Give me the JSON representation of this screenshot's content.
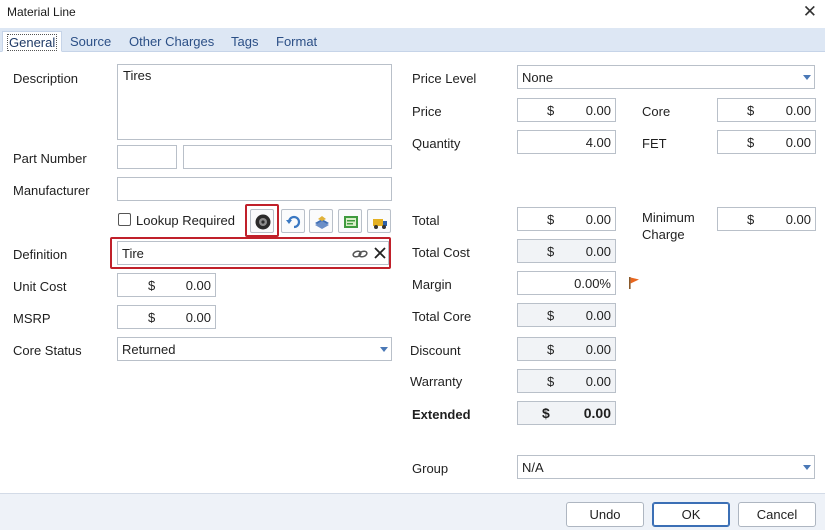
{
  "window": {
    "title": "Material Line",
    "close_symbol": "✕"
  },
  "tabs": [
    {
      "label": "General",
      "active": true
    },
    {
      "label": "Source"
    },
    {
      "label": "Other Charges"
    },
    {
      "label": "Tags"
    },
    {
      "label": "Format"
    }
  ],
  "left": {
    "description_label": "Description",
    "description_value": "Tires",
    "part_number_label": "Part Number",
    "part_number_value_1": "",
    "part_number_value_2": "",
    "manufacturer_label": "Manufacturer",
    "manufacturer_value": "",
    "lookup_label": "Lookup Required",
    "lookup_checked": false,
    "definition_label": "Definition",
    "definition_value": "Tire",
    "unit_cost_label": "Unit Cost",
    "unit_cost_currency": "$",
    "unit_cost_value": "0.00",
    "msrp_label": "MSRP",
    "msrp_currency": "$",
    "msrp_value": "0.00",
    "core_status_label": "Core Status",
    "core_status_value": "Returned"
  },
  "right": {
    "price_level_label": "Price Level",
    "price_level_value": "None",
    "price_label": "Price",
    "price_currency": "$",
    "price_value": "0.00",
    "core_label": "Core",
    "core_currency": "$",
    "core_value": "0.00",
    "quantity_label": "Quantity",
    "quantity_value": "4.00",
    "fet_label": "FET",
    "fet_currency": "$",
    "fet_value": "0.00",
    "total_label": "Total",
    "total_currency": "$",
    "total_value": "0.00",
    "minimum_charge_label_1": "Minimum",
    "minimum_charge_label_2": "Charge",
    "minimum_charge_currency": "$",
    "minimum_charge_value": "0.00",
    "total_cost_label": "Total Cost",
    "total_cost_currency": "$",
    "total_cost_value": "0.00",
    "margin_label": "Margin",
    "margin_value": "0.00%",
    "total_core_label": "Total Core",
    "total_core_currency": "$",
    "total_core_value": "0.00",
    "discount_label": "Discount",
    "discount_currency": "$",
    "discount_value": "0.00",
    "warranty_label": "Warranty",
    "warranty_currency": "$",
    "warranty_value": "0.00",
    "extended_label": "Extended",
    "extended_currency": "$",
    "extended_value": "0.00",
    "group_label": "Group",
    "group_value": "N/A"
  },
  "buttons": {
    "undo": "Undo",
    "ok": "OK",
    "cancel": "Cancel"
  },
  "colors": {
    "accent": "#3b6fb5",
    "highlight_red": "#c0202a",
    "tab_bar": "#dde7f4",
    "footer": "#eef2f8"
  }
}
